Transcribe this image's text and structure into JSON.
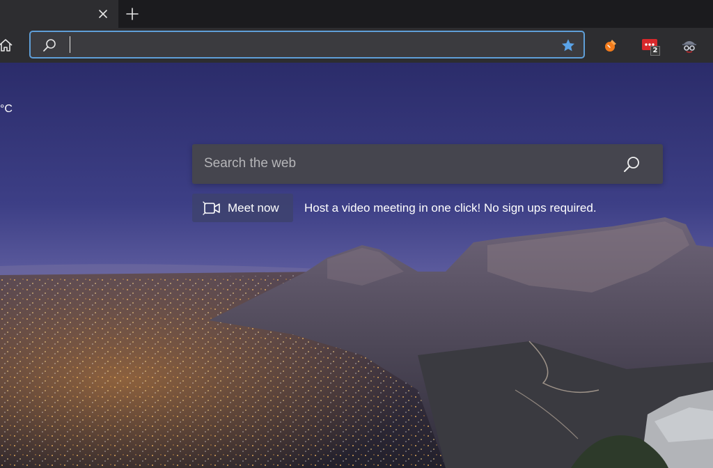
{
  "browser": {
    "tab_close_icon": "close-icon",
    "new_tab_icon": "plus-icon"
  },
  "toolbar": {
    "home_icon": "home-icon",
    "address_value": "",
    "address_search_icon": "search-icon",
    "favorite_icon": "star-icon",
    "favorite_color": "#5aa3e8",
    "accent_border": "#5f9fd8",
    "extensions": [
      {
        "name": "torch-extension",
        "icon": "torch-icon",
        "color": "#f27b1b"
      },
      {
        "name": "password-manager-extension",
        "icon": "dots-icon",
        "color": "#d8282b",
        "badge": "2"
      },
      {
        "name": "spy-extension",
        "icon": "spy-icon",
        "color": "#9aa0b0"
      }
    ]
  },
  "page": {
    "weather_unit": "°C",
    "search": {
      "placeholder": "Search the web",
      "icon": "search-icon"
    },
    "meet": {
      "label": "Meet now",
      "icon": "video-camera-icon",
      "description": "Host a video meeting in one click! No sign ups required."
    }
  }
}
